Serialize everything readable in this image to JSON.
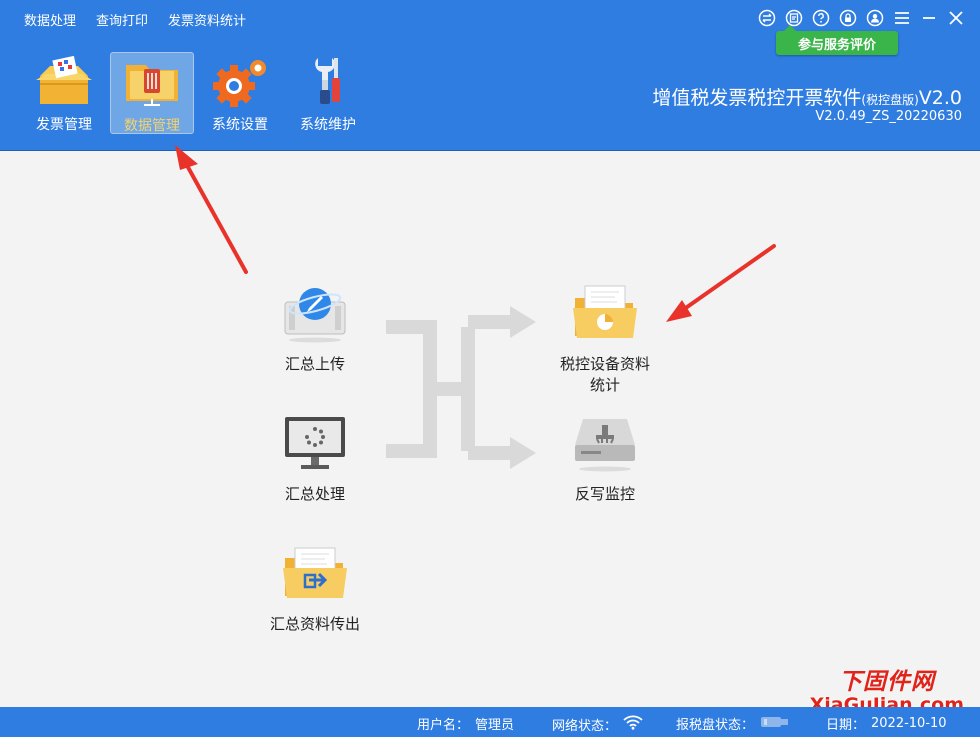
{
  "menu": [
    "数据处理",
    "查询打印",
    "发票资料统计"
  ],
  "header_icons": [
    "switch-icon",
    "feedback-icon",
    "help-icon",
    "lock-icon",
    "user-icon",
    "menu-icon",
    "minimize-icon",
    "close-icon"
  ],
  "eval_button": "参与服务评价",
  "modules": [
    {
      "label": "发票管理",
      "icon": "invoice-box-icon"
    },
    {
      "label": "数据管理",
      "icon": "data-folder-icon",
      "active": true
    },
    {
      "label": "系统设置",
      "icon": "gears-icon"
    },
    {
      "label": "系统维护",
      "icon": "tools-icon"
    }
  ],
  "app": {
    "title": "增值税发票税控开票软件",
    "edition": "(税控盘版)",
    "version_suffix": "V2.0",
    "build": "V2.0.49_ZS_20220630"
  },
  "flow": {
    "upload": "汇总上传",
    "process": "汇总处理",
    "export": "汇总资料传出",
    "stats_line1": "税控设备资料",
    "stats_line2": "统计",
    "writeback": "反写监控"
  },
  "status": {
    "user_label": "用户名：",
    "user_value": "管理员",
    "network_label": "网络状态：",
    "disk_label": "报税盘状态：",
    "date_label": "日期：",
    "date_value": "2022-10-10"
  },
  "watermark": {
    "line1": "下固件网",
    "line2": "XiaGuJian.com"
  },
  "colors": {
    "header": "#2f7de1",
    "active_module": "#6fa6e6",
    "eval": "#39b54a",
    "annotation_arrow": "#e8322a"
  }
}
